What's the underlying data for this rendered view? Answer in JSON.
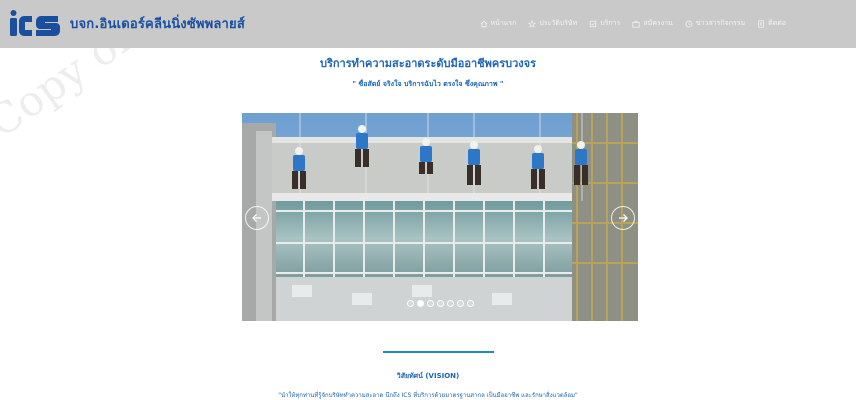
{
  "brand": {
    "logo_letters": "ICS",
    "company_name": "บจก.อินเดอร์คลีนนิ่งซัพพลายส์",
    "logo_color": "#1a4f9e"
  },
  "nav": {
    "items": [
      {
        "label": "หน้าแรก",
        "icon": "home-icon"
      },
      {
        "label": "ประวัติบริษัท",
        "icon": "history-icon"
      },
      {
        "label": "บริการ",
        "icon": "service-icon"
      },
      {
        "label": "สมัครงาน",
        "icon": "job-icon"
      },
      {
        "label": "ข่าวสารกิจกรรม",
        "icon": "news-icon"
      },
      {
        "label": "ติดต่อ",
        "icon": "contact-icon"
      }
    ]
  },
  "watermark": "Copy of ICS",
  "hero": {
    "title": "บริการทำความสะอาดระดับมืออาชีพครบวงจร",
    "slogan": "\" ซื่อสัตย์ จริงใจ บริการฉับไว ตรงใจ ซึ่งคุณภาพ \""
  },
  "carousel": {
    "slide_count": 7,
    "active_index": 1,
    "prev_icon": "arrow-left-icon",
    "next_icon": "arrow-right-icon"
  },
  "vision": {
    "title": "วิสัยทัศน์ (VISION)",
    "text": "\"นำให้ทุกท่านที่รู้จักบริษัททำความสะอาด นึกถึง ICS ที่บริการด้วยมาตรฐานสากล เป็นมืออาชีพ และรักษาสิ่งแวดล้อม\""
  },
  "colors": {
    "navbar_bg": "#c9c9c9",
    "accent_blue": "#1e66b3",
    "divider": "#1e88c8"
  }
}
